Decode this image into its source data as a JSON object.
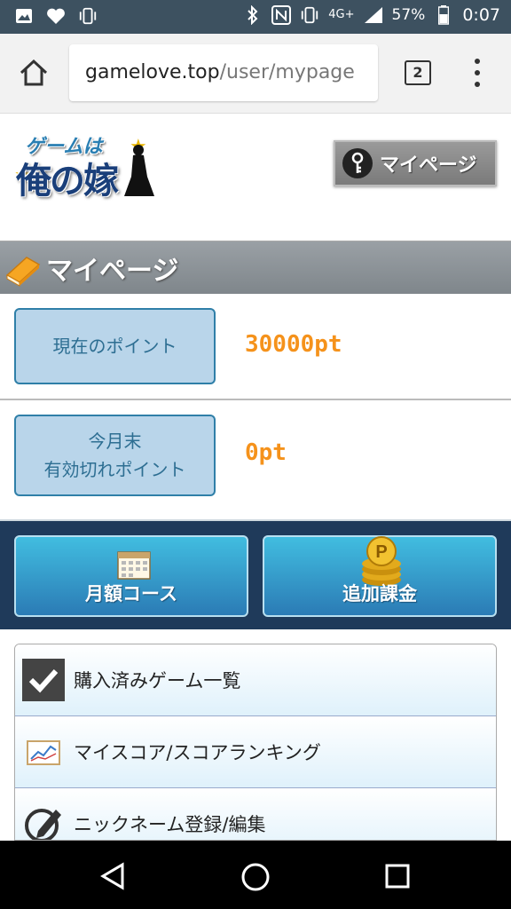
{
  "status_bar": {
    "network": "4G+",
    "battery": "57%",
    "time": "0:07"
  },
  "browser": {
    "url_host": "gamelove.top",
    "url_path": "/user/mypage",
    "tab_count": "2"
  },
  "header": {
    "logo_top": "ゲームは",
    "logo_main": "俺の嫁",
    "mypage_button": "マイページ"
  },
  "section": {
    "title": "マイページ"
  },
  "points": {
    "current_label": "現在のポイント",
    "current_value": "30000pt",
    "expiring_label_line1": "今月末",
    "expiring_label_line2": "有効切れポイント",
    "expiring_value": "0pt"
  },
  "actions": {
    "monthly_course": "月額コース",
    "additional_charge": "追加課金"
  },
  "menu": {
    "items": [
      {
        "label": "購入済みゲーム一覧",
        "icon": "checkbox-icon"
      },
      {
        "label": "マイスコア/スコアランキング",
        "icon": "chart-icon"
      },
      {
        "label": "ニックネーム登録/編集",
        "icon": "edit-icon"
      }
    ]
  },
  "colors": {
    "status_bar": "#3d5160",
    "accent_orange": "#f5921b",
    "label_bg": "#b9d5ea",
    "action_band": "#1f3a5a",
    "action_button": "#2b7bb5"
  }
}
